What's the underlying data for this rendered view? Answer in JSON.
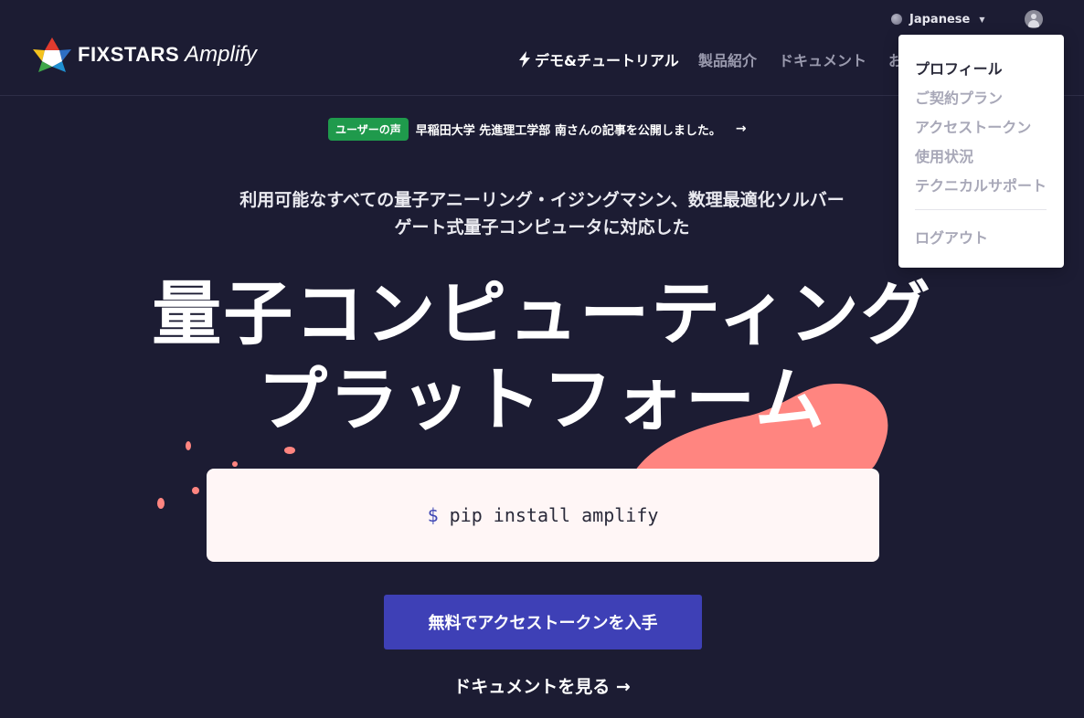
{
  "header": {
    "language": "Japanese",
    "logo_brand": "FIXSTARS",
    "logo_product": "Amplify",
    "nav": {
      "demo": "デモ&チュートリアル",
      "products": "製品紹介",
      "docs": "ドキュメント",
      "more": "お"
    }
  },
  "announcement": {
    "badge": "ユーザーの声",
    "text": "早稲田大学 先進理工学部 南さんの記事を公開しました。",
    "arrow": "→"
  },
  "hero": {
    "subtitle_line1": "利用可能なすべての量子アニーリング・イジングマシン、数理最適化ソルバー",
    "subtitle_line2": "ゲート式量子コンピュータに対応した",
    "title_line1": "量子コンピューティング",
    "title_line2": "プラットフォーム"
  },
  "install": {
    "prompt": "$",
    "command": "pip install amplify"
  },
  "cta": {
    "primary": "無料でアクセストークンを入手",
    "secondary": "ドキュメントを見る →"
  },
  "user_menu": {
    "items": [
      "プロフィール",
      "ご契約プラン",
      "アクセストークン",
      "使用状況",
      "テクニカルサポート"
    ],
    "logout": "ログアウト"
  },
  "colors": {
    "background": "#1c1c33",
    "accent": "#3e40b6",
    "badge": "#1f9a4c",
    "blob": "#ff8580",
    "code_bg": "#fff6f6"
  },
  "icons": [
    "globe-icon",
    "chevron-down-icon",
    "user-avatar-icon",
    "lightning-icon",
    "arrow-right-icon",
    "fixstars-star-logo"
  ]
}
